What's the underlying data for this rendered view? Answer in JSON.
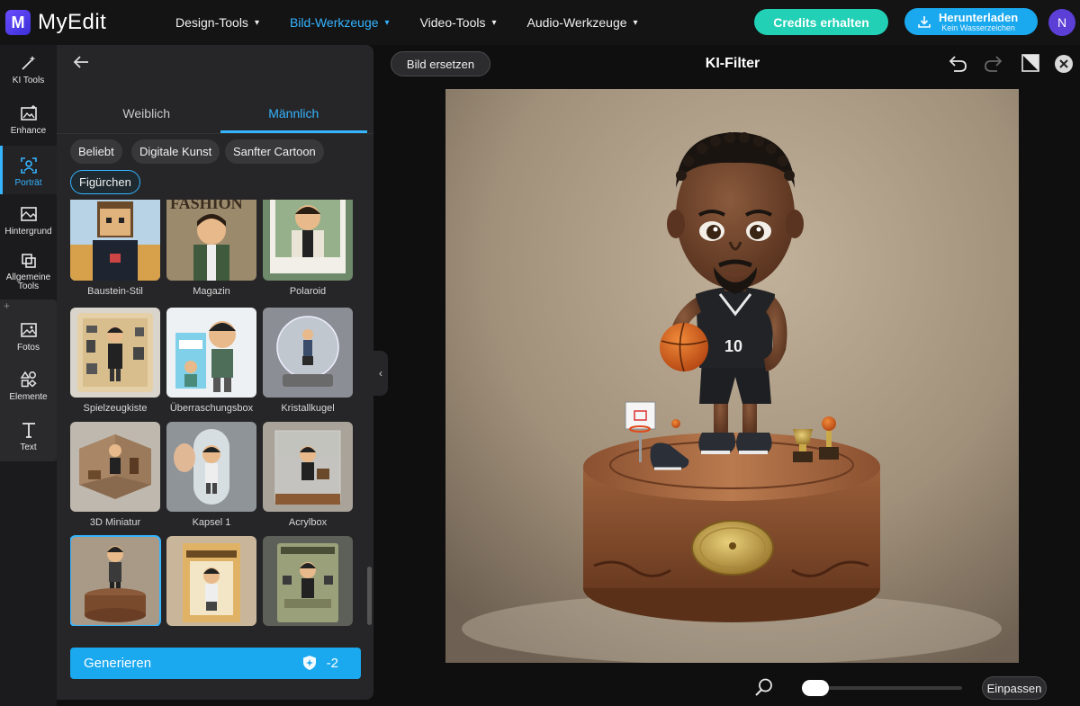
{
  "app": {
    "logo_text": "MyEdit",
    "logo_letter": "M"
  },
  "nav": {
    "items": [
      {
        "label": "Design-Tools",
        "active": false
      },
      {
        "label": "Bild-Werkzeuge",
        "active": true
      },
      {
        "label": "Video-Tools",
        "active": false
      },
      {
        "label": "Audio-Werkzeuge",
        "active": false
      }
    ]
  },
  "header": {
    "credits_label": "Credits erhalten",
    "download_label": "Herunterladen",
    "download_sub": "Kein Wasserzeichen",
    "avatar_initial": "N"
  },
  "rail": {
    "items": [
      {
        "label": "KI Tools",
        "icon": "magic-wand-icon"
      },
      {
        "label": "Enhance",
        "icon": "image-enhance-icon"
      },
      {
        "label": "Porträt",
        "icon": "portrait-icon",
        "active": true
      },
      {
        "label": "Hintergrund",
        "icon": "background-icon"
      },
      {
        "label": "Allgemeine Tools",
        "icon": "general-tools-icon"
      },
      {
        "label": "Fotos",
        "icon": "photos-icon"
      },
      {
        "label": "Elemente",
        "icon": "elements-icon"
      },
      {
        "label": "Text",
        "icon": "text-icon"
      }
    ]
  },
  "panel": {
    "tabs": [
      {
        "label": "Weiblich",
        "active": false
      },
      {
        "label": "Männlich",
        "active": true
      }
    ],
    "chips": [
      {
        "label": "Beliebt",
        "active": false
      },
      {
        "label": "Digitale Kunst",
        "active": false
      },
      {
        "label": "Sanfter Cartoon",
        "active": false
      },
      {
        "label": "Figürchen",
        "active": true
      }
    ],
    "styles": [
      {
        "label": "Baustein-Stil"
      },
      {
        "label": "Magazin"
      },
      {
        "label": "Polaroid"
      },
      {
        "label": "Spielzeugkiste"
      },
      {
        "label": "Überraschungsbox"
      },
      {
        "label": "Kristallkugel"
      },
      {
        "label": "3D Miniatur"
      },
      {
        "label": "Kapsel 1"
      },
      {
        "label": "Acrylbox"
      },
      {
        "label": "",
        "selected": true
      },
      {
        "label": ""
      },
      {
        "label": ""
      }
    ],
    "magazine_text": "FASHION",
    "generate_label": "Generieren",
    "generate_cost": "-2"
  },
  "editor": {
    "replace_label": "Bild ersetzen",
    "title": "KI-Filter",
    "fit_label": "Einpassen",
    "jersey_number": "10",
    "zoom_level": 0.05
  },
  "colors": {
    "accent": "#35b4ff",
    "credits": "#21d0b5",
    "download": "#1aa8ee"
  }
}
